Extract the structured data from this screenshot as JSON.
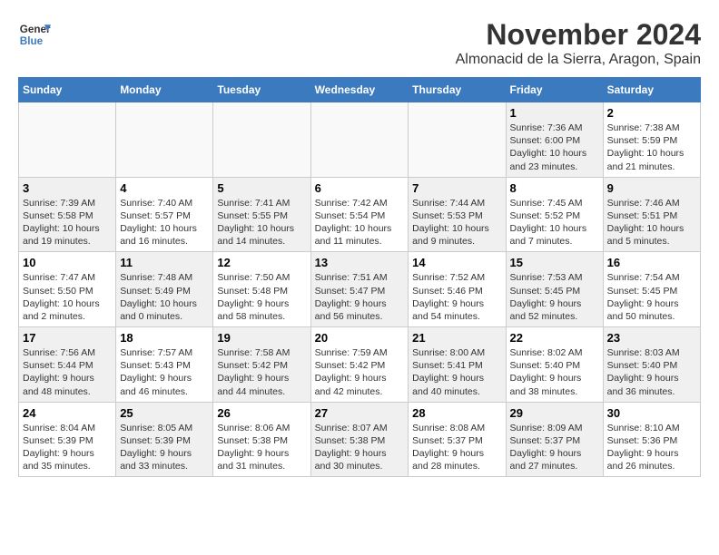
{
  "header": {
    "logo_line1": "General",
    "logo_line2": "Blue",
    "month": "November 2024",
    "location": "Almonacid de la Sierra, Aragon, Spain"
  },
  "weekdays": [
    "Sunday",
    "Monday",
    "Tuesday",
    "Wednesday",
    "Thursday",
    "Friday",
    "Saturday"
  ],
  "weeks": [
    [
      {
        "day": "",
        "info": "",
        "empty": true
      },
      {
        "day": "",
        "info": "",
        "empty": true
      },
      {
        "day": "",
        "info": "",
        "empty": true
      },
      {
        "day": "",
        "info": "",
        "empty": true
      },
      {
        "day": "",
        "info": "",
        "empty": true
      },
      {
        "day": "1",
        "info": "Sunrise: 7:36 AM\nSunset: 6:00 PM\nDaylight: 10 hours and 23 minutes.",
        "shaded": true
      },
      {
        "day": "2",
        "info": "Sunrise: 7:38 AM\nSunset: 5:59 PM\nDaylight: 10 hours and 21 minutes.",
        "shaded": false
      }
    ],
    [
      {
        "day": "3",
        "info": "Sunrise: 7:39 AM\nSunset: 5:58 PM\nDaylight: 10 hours and 19 minutes.",
        "shaded": true
      },
      {
        "day": "4",
        "info": "Sunrise: 7:40 AM\nSunset: 5:57 PM\nDaylight: 10 hours and 16 minutes.",
        "shaded": false
      },
      {
        "day": "5",
        "info": "Sunrise: 7:41 AM\nSunset: 5:55 PM\nDaylight: 10 hours and 14 minutes.",
        "shaded": true
      },
      {
        "day": "6",
        "info": "Sunrise: 7:42 AM\nSunset: 5:54 PM\nDaylight: 10 hours and 11 minutes.",
        "shaded": false
      },
      {
        "day": "7",
        "info": "Sunrise: 7:44 AM\nSunset: 5:53 PM\nDaylight: 10 hours and 9 minutes.",
        "shaded": true
      },
      {
        "day": "8",
        "info": "Sunrise: 7:45 AM\nSunset: 5:52 PM\nDaylight: 10 hours and 7 minutes.",
        "shaded": false
      },
      {
        "day": "9",
        "info": "Sunrise: 7:46 AM\nSunset: 5:51 PM\nDaylight: 10 hours and 5 minutes.",
        "shaded": true
      }
    ],
    [
      {
        "day": "10",
        "info": "Sunrise: 7:47 AM\nSunset: 5:50 PM\nDaylight: 10 hours and 2 minutes.",
        "shaded": false
      },
      {
        "day": "11",
        "info": "Sunrise: 7:48 AM\nSunset: 5:49 PM\nDaylight: 10 hours and 0 minutes.",
        "shaded": true
      },
      {
        "day": "12",
        "info": "Sunrise: 7:50 AM\nSunset: 5:48 PM\nDaylight: 9 hours and 58 minutes.",
        "shaded": false
      },
      {
        "day": "13",
        "info": "Sunrise: 7:51 AM\nSunset: 5:47 PM\nDaylight: 9 hours and 56 minutes.",
        "shaded": true
      },
      {
        "day": "14",
        "info": "Sunrise: 7:52 AM\nSunset: 5:46 PM\nDaylight: 9 hours and 54 minutes.",
        "shaded": false
      },
      {
        "day": "15",
        "info": "Sunrise: 7:53 AM\nSunset: 5:45 PM\nDaylight: 9 hours and 52 minutes.",
        "shaded": true
      },
      {
        "day": "16",
        "info": "Sunrise: 7:54 AM\nSunset: 5:45 PM\nDaylight: 9 hours and 50 minutes.",
        "shaded": false
      }
    ],
    [
      {
        "day": "17",
        "info": "Sunrise: 7:56 AM\nSunset: 5:44 PM\nDaylight: 9 hours and 48 minutes.",
        "shaded": true
      },
      {
        "day": "18",
        "info": "Sunrise: 7:57 AM\nSunset: 5:43 PM\nDaylight: 9 hours and 46 minutes.",
        "shaded": false
      },
      {
        "day": "19",
        "info": "Sunrise: 7:58 AM\nSunset: 5:42 PM\nDaylight: 9 hours and 44 minutes.",
        "shaded": true
      },
      {
        "day": "20",
        "info": "Sunrise: 7:59 AM\nSunset: 5:42 PM\nDaylight: 9 hours and 42 minutes.",
        "shaded": false
      },
      {
        "day": "21",
        "info": "Sunrise: 8:00 AM\nSunset: 5:41 PM\nDaylight: 9 hours and 40 minutes.",
        "shaded": true
      },
      {
        "day": "22",
        "info": "Sunrise: 8:02 AM\nSunset: 5:40 PM\nDaylight: 9 hours and 38 minutes.",
        "shaded": false
      },
      {
        "day": "23",
        "info": "Sunrise: 8:03 AM\nSunset: 5:40 PM\nDaylight: 9 hours and 36 minutes.",
        "shaded": true
      }
    ],
    [
      {
        "day": "24",
        "info": "Sunrise: 8:04 AM\nSunset: 5:39 PM\nDaylight: 9 hours and 35 minutes.",
        "shaded": false
      },
      {
        "day": "25",
        "info": "Sunrise: 8:05 AM\nSunset: 5:39 PM\nDaylight: 9 hours and 33 minutes.",
        "shaded": true
      },
      {
        "day": "26",
        "info": "Sunrise: 8:06 AM\nSunset: 5:38 PM\nDaylight: 9 hours and 31 minutes.",
        "shaded": false
      },
      {
        "day": "27",
        "info": "Sunrise: 8:07 AM\nSunset: 5:38 PM\nDaylight: 9 hours and 30 minutes.",
        "shaded": true
      },
      {
        "day": "28",
        "info": "Sunrise: 8:08 AM\nSunset: 5:37 PM\nDaylight: 9 hours and 28 minutes.",
        "shaded": false
      },
      {
        "day": "29",
        "info": "Sunrise: 8:09 AM\nSunset: 5:37 PM\nDaylight: 9 hours and 27 minutes.",
        "shaded": true
      },
      {
        "day": "30",
        "info": "Sunrise: 8:10 AM\nSunset: 5:36 PM\nDaylight: 9 hours and 26 minutes.",
        "shaded": false
      }
    ]
  ]
}
